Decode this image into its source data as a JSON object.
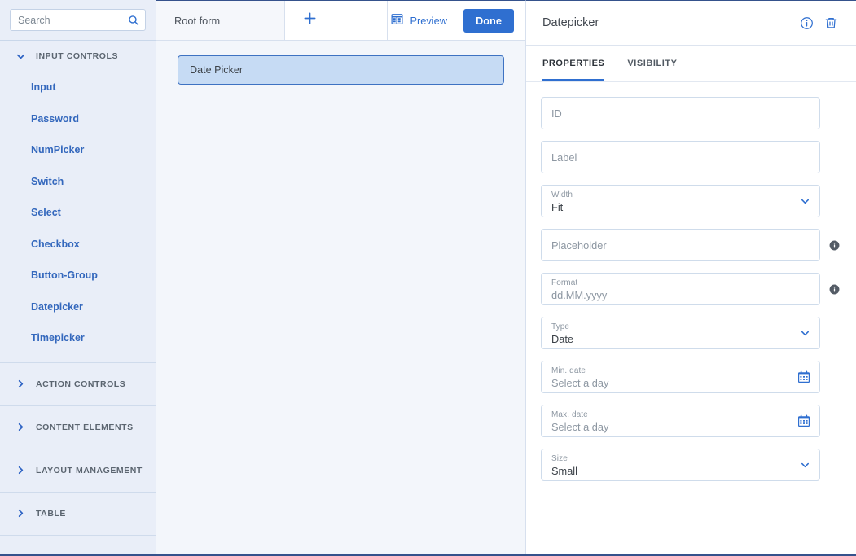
{
  "search": {
    "placeholder": "Search",
    "value": "",
    "icon": "search-icon"
  },
  "sidebar": {
    "sections": [
      {
        "title": "INPUT CONTROLS",
        "expanded": true,
        "icon": "chevron-down-icon",
        "items": [
          {
            "label": "Input"
          },
          {
            "label": "Password"
          },
          {
            "label": "NumPicker"
          },
          {
            "label": "Switch"
          },
          {
            "label": "Select"
          },
          {
            "label": "Checkbox"
          },
          {
            "label": "Button-Group"
          },
          {
            "label": "Datepicker"
          },
          {
            "label": "Timepicker"
          }
        ]
      },
      {
        "title": "ACTION CONTROLS",
        "expanded": false,
        "icon": "chevron-right-icon",
        "items": []
      },
      {
        "title": "CONTENT ELEMENTS",
        "expanded": false,
        "icon": "chevron-right-icon",
        "items": []
      },
      {
        "title": "LAYOUT MANAGEMENT",
        "expanded": false,
        "icon": "chevron-right-icon",
        "items": []
      },
      {
        "title": "TABLE",
        "expanded": false,
        "icon": "chevron-right-icon",
        "items": []
      }
    ]
  },
  "tabbar": {
    "form_tab_label": "Root form",
    "add_tab_icon": "plus-icon",
    "preview_label": "Preview",
    "preview_icon": "layout-preview-icon",
    "done_label": "Done"
  },
  "canvas": {
    "widgets": [
      {
        "label": "Date Picker",
        "selected": true
      }
    ]
  },
  "panel": {
    "title": "Datepicker",
    "info_icon": "info-circle-icon",
    "delete_icon": "trash-icon",
    "tabs": [
      {
        "label": "PROPERTIES",
        "active": true
      },
      {
        "label": "VISIBILITY",
        "active": false
      }
    ],
    "fields": [
      {
        "name": "id",
        "label": "",
        "placeholder": "ID",
        "value": "",
        "type": "text",
        "info": false
      },
      {
        "name": "label",
        "label": "",
        "placeholder": "Label",
        "value": "",
        "type": "text",
        "info": false
      },
      {
        "name": "width",
        "label": "Width",
        "placeholder": "",
        "value": "Fit",
        "type": "select",
        "info": false
      },
      {
        "name": "placeholder",
        "label": "",
        "placeholder": "Placeholder",
        "value": "",
        "type": "text",
        "info": true
      },
      {
        "name": "format",
        "label": "Format",
        "placeholder": "dd.MM.yyyy",
        "value": "",
        "type": "text",
        "info": true
      },
      {
        "name": "type",
        "label": "Type",
        "placeholder": "",
        "value": "Date",
        "type": "select",
        "info": false
      },
      {
        "name": "min-date",
        "label": "Min. date",
        "placeholder": "Select a day",
        "value": "",
        "type": "date",
        "info": false
      },
      {
        "name": "max-date",
        "label": "Max. date",
        "placeholder": "Select a day",
        "value": "",
        "type": "date",
        "info": false
      },
      {
        "name": "size",
        "label": "Size",
        "placeholder": "",
        "value": "Small",
        "type": "select",
        "info": false
      }
    ]
  },
  "colors": {
    "accent": "#2f6fd0",
    "sidebar_bg": "#e9eef8",
    "canvas_bg": "#f3f6fb",
    "selected_widget_bg": "#c6dbf4",
    "selected_widget_border": "#3e72c2",
    "top_border": "#35528c"
  }
}
